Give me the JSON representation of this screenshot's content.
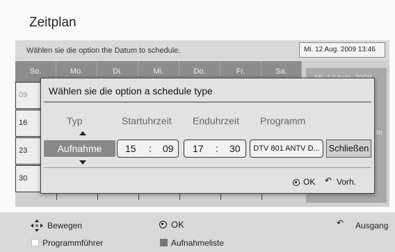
{
  "title": "Zeitplan",
  "instruction": "Wählen sie die option the Datum to schedule.",
  "current_datetime": "Mi. 12 Aug. 2009 13:46",
  "calendar": {
    "days": [
      "So.",
      "Mo.",
      "Di.",
      "Mi.",
      "Do.",
      "Fr.",
      "Sa."
    ],
    "weeks": [
      "09",
      "16",
      "23",
      "30"
    ]
  },
  "background_panel_text": {
    "datetime": "Mi. 12 Aug. 2009",
    "tail": "te"
  },
  "dialog": {
    "title": "Wählen sie die option a schedule type",
    "columns": {
      "type": "Typ",
      "start": "Startuhrzeit",
      "end": "Enduhrzeit",
      "program": "Programm"
    },
    "type_value": "Aufnahme",
    "start_hour": "15",
    "start_minute": "09",
    "end_hour": "17",
    "end_minute": "30",
    "time_separator": ":",
    "program_value": "DTV 801 ANTV D...",
    "close_label": "Schließen",
    "footer": {
      "ok_label": "OK",
      "back_label": "Vorh."
    }
  },
  "bottom": {
    "move_label": "Bewegen",
    "ok_label": "OK",
    "exit_label": "Ausgang",
    "legend": [
      {
        "label": "Programmführer",
        "color": "#ffffff"
      },
      {
        "label": "Aufnahmeliste",
        "color": "#777777"
      }
    ]
  },
  "icons": {
    "move": "four-way-arrow-icon",
    "ok": "ok-circle-icon",
    "back": "return-arrow-icon"
  }
}
